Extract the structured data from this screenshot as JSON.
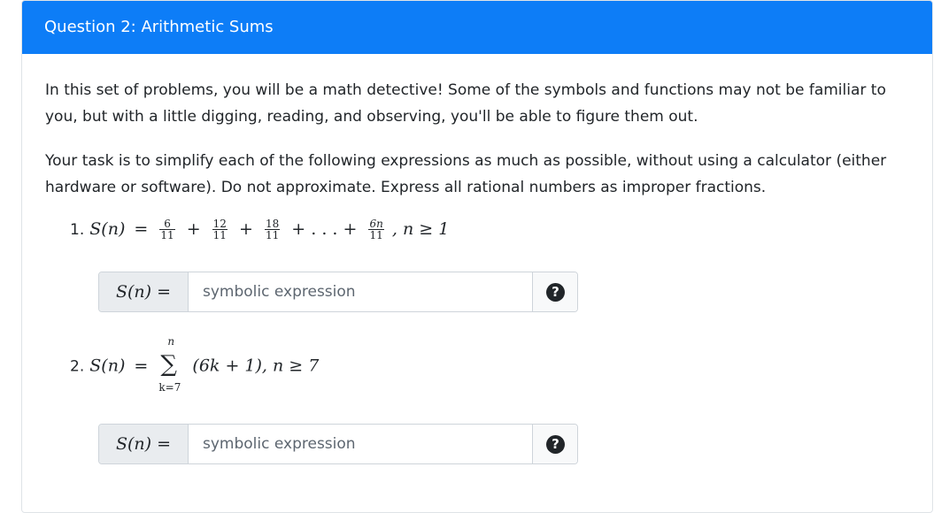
{
  "header": {
    "title": "Question 2: Arithmetic Sums"
  },
  "intro": {
    "paragraph1": "In this set of problems, you will be a math detective! Some of the symbols and functions may not be familiar to you, but with a little digging, reading, and observing, you'll be able to figure them out.",
    "paragraph2": "Your task is to simplify each of the following expressions as much as possible, without using a calculator (either hardware or software). Do not approximate. Express all rational numbers as improper fractions."
  },
  "problems": [
    {
      "number": "1.",
      "lhs": "S(n)",
      "eq": "=",
      "terms": [
        {
          "num": "6",
          "den": "11"
        },
        {
          "num": "12",
          "den": "11"
        },
        {
          "num": "18",
          "den": "11"
        },
        {
          "num": "6n",
          "den": "11"
        }
      ],
      "plus": "+",
      "dots": "+ . . . +",
      "condition": ", n ≥ 1",
      "answer_label": "S(n) =",
      "placeholder": "symbolic expression",
      "help": "?"
    },
    {
      "number": "2.",
      "lhs": "S(n)",
      "eq": "=",
      "sum_upper": "n",
      "sum_symbol": "∑",
      "sum_lower": "k=7",
      "summand": "(6k + 1), n ≥ 7",
      "answer_label": "S(n) =",
      "placeholder": "symbolic expression",
      "help": "?"
    }
  ],
  "colors": {
    "header_bg": "#0d7df7",
    "header_text": "#ffffff"
  }
}
